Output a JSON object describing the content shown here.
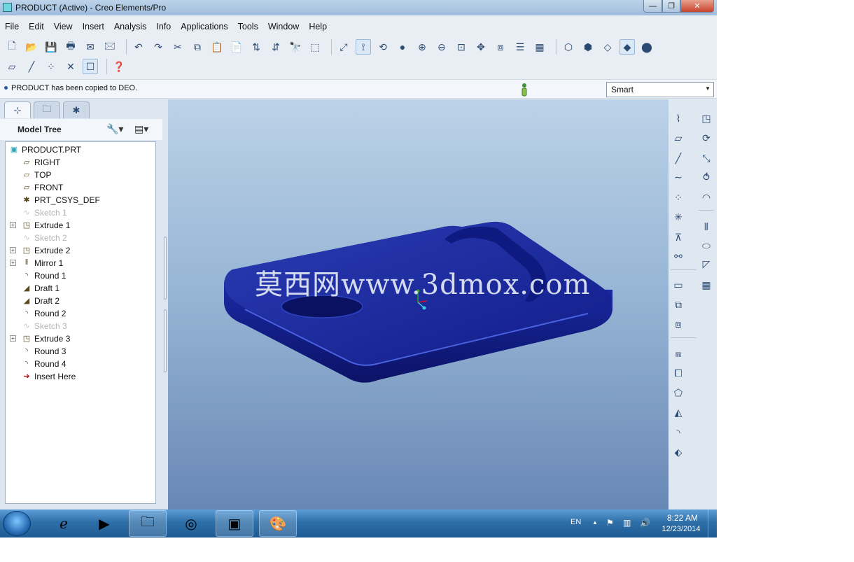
{
  "window": {
    "title": "PRODUCT (Active) - Creo Elements/Pro",
    "minimize": "—",
    "maximize": "❐",
    "close": "✕"
  },
  "menu": [
    {
      "label": "File"
    },
    {
      "label": "Edit"
    },
    {
      "label": "View"
    },
    {
      "label": "Insert"
    },
    {
      "label": "Analysis"
    },
    {
      "label": "Info"
    },
    {
      "label": "Applications"
    },
    {
      "label": "Tools"
    },
    {
      "label": "Window"
    },
    {
      "label": "Help"
    }
  ],
  "message": {
    "text": "PRODUCT has been copied to DEO.",
    "filter_selected": "Smart"
  },
  "model_tree": {
    "title": "Model Tree",
    "items": [
      {
        "label": "PRODUCT.PRT",
        "icon": "part-icon",
        "level": 0,
        "expandable": false,
        "suppressed": false
      },
      {
        "label": "RIGHT",
        "icon": "datum-plane-icon",
        "level": 1,
        "expandable": false,
        "suppressed": false
      },
      {
        "label": "TOP",
        "icon": "datum-plane-icon",
        "level": 1,
        "expandable": false,
        "suppressed": false
      },
      {
        "label": "FRONT",
        "icon": "datum-plane-icon",
        "level": 1,
        "expandable": false,
        "suppressed": false
      },
      {
        "label": "PRT_CSYS_DEF",
        "icon": "coordinate-system-icon",
        "level": 1,
        "expandable": false,
        "suppressed": false
      },
      {
        "label": "Sketch 1",
        "icon": "sketch-icon",
        "level": 1,
        "expandable": false,
        "suppressed": true
      },
      {
        "label": "Extrude 1",
        "icon": "extrude-icon",
        "level": 1,
        "expandable": true,
        "suppressed": false
      },
      {
        "label": "Sketch 2",
        "icon": "sketch-icon",
        "level": 1,
        "expandable": false,
        "suppressed": true
      },
      {
        "label": "Extrude 2",
        "icon": "extrude-icon",
        "level": 1,
        "expandable": true,
        "suppressed": false
      },
      {
        "label": "Mirror 1",
        "icon": "mirror-icon",
        "level": 1,
        "expandable": true,
        "suppressed": false
      },
      {
        "label": "Round 1",
        "icon": "round-icon",
        "level": 1,
        "expandable": false,
        "suppressed": false
      },
      {
        "label": "Draft 1",
        "icon": "draft-icon",
        "level": 1,
        "expandable": false,
        "suppressed": false
      },
      {
        "label": "Draft 2",
        "icon": "draft-icon",
        "level": 1,
        "expandable": false,
        "suppressed": false
      },
      {
        "label": "Round 2",
        "icon": "round-icon",
        "level": 1,
        "expandable": false,
        "suppressed": false
      },
      {
        "label": "Sketch 3",
        "icon": "sketch-icon",
        "level": 1,
        "expandable": false,
        "suppressed": true
      },
      {
        "label": "Extrude 3",
        "icon": "extrude-icon",
        "level": 1,
        "expandable": true,
        "suppressed": false
      },
      {
        "label": "Round 3",
        "icon": "round-icon",
        "level": 1,
        "expandable": false,
        "suppressed": false
      },
      {
        "label": "Round 4",
        "icon": "round-icon",
        "level": 1,
        "expandable": false,
        "suppressed": false
      },
      {
        "label": "Insert Here",
        "icon": "insert-arrow-icon",
        "level": 1,
        "expandable": false,
        "suppressed": false
      }
    ]
  },
  "viewport": {
    "watermark": "莫西网www.3dmox.com",
    "model_color": "#1a2a9a",
    "background_top": "#bcd2e8",
    "background_bottom": "#6987b5"
  },
  "taskbar": {
    "language": "EN",
    "time": "8:22 AM",
    "date": "12/23/2014",
    "apps": [
      {
        "name": "internet-explorer-icon"
      },
      {
        "name": "media-player-icon"
      },
      {
        "name": "file-explorer-icon"
      },
      {
        "name": "chrome-icon"
      },
      {
        "name": "creo-icon"
      },
      {
        "name": "paint-icon"
      }
    ]
  },
  "icons": {
    "expander_plus": "+",
    "tree_glyphs": {
      "part-icon": "▣",
      "datum-plane-icon": "▱",
      "coordinate-system-icon": "✱",
      "sketch-icon": "∿",
      "extrude-icon": "◳",
      "mirror-icon": "‖",
      "round-icon": "◝",
      "draft-icon": "◢",
      "insert-arrow-icon": "➔"
    }
  }
}
